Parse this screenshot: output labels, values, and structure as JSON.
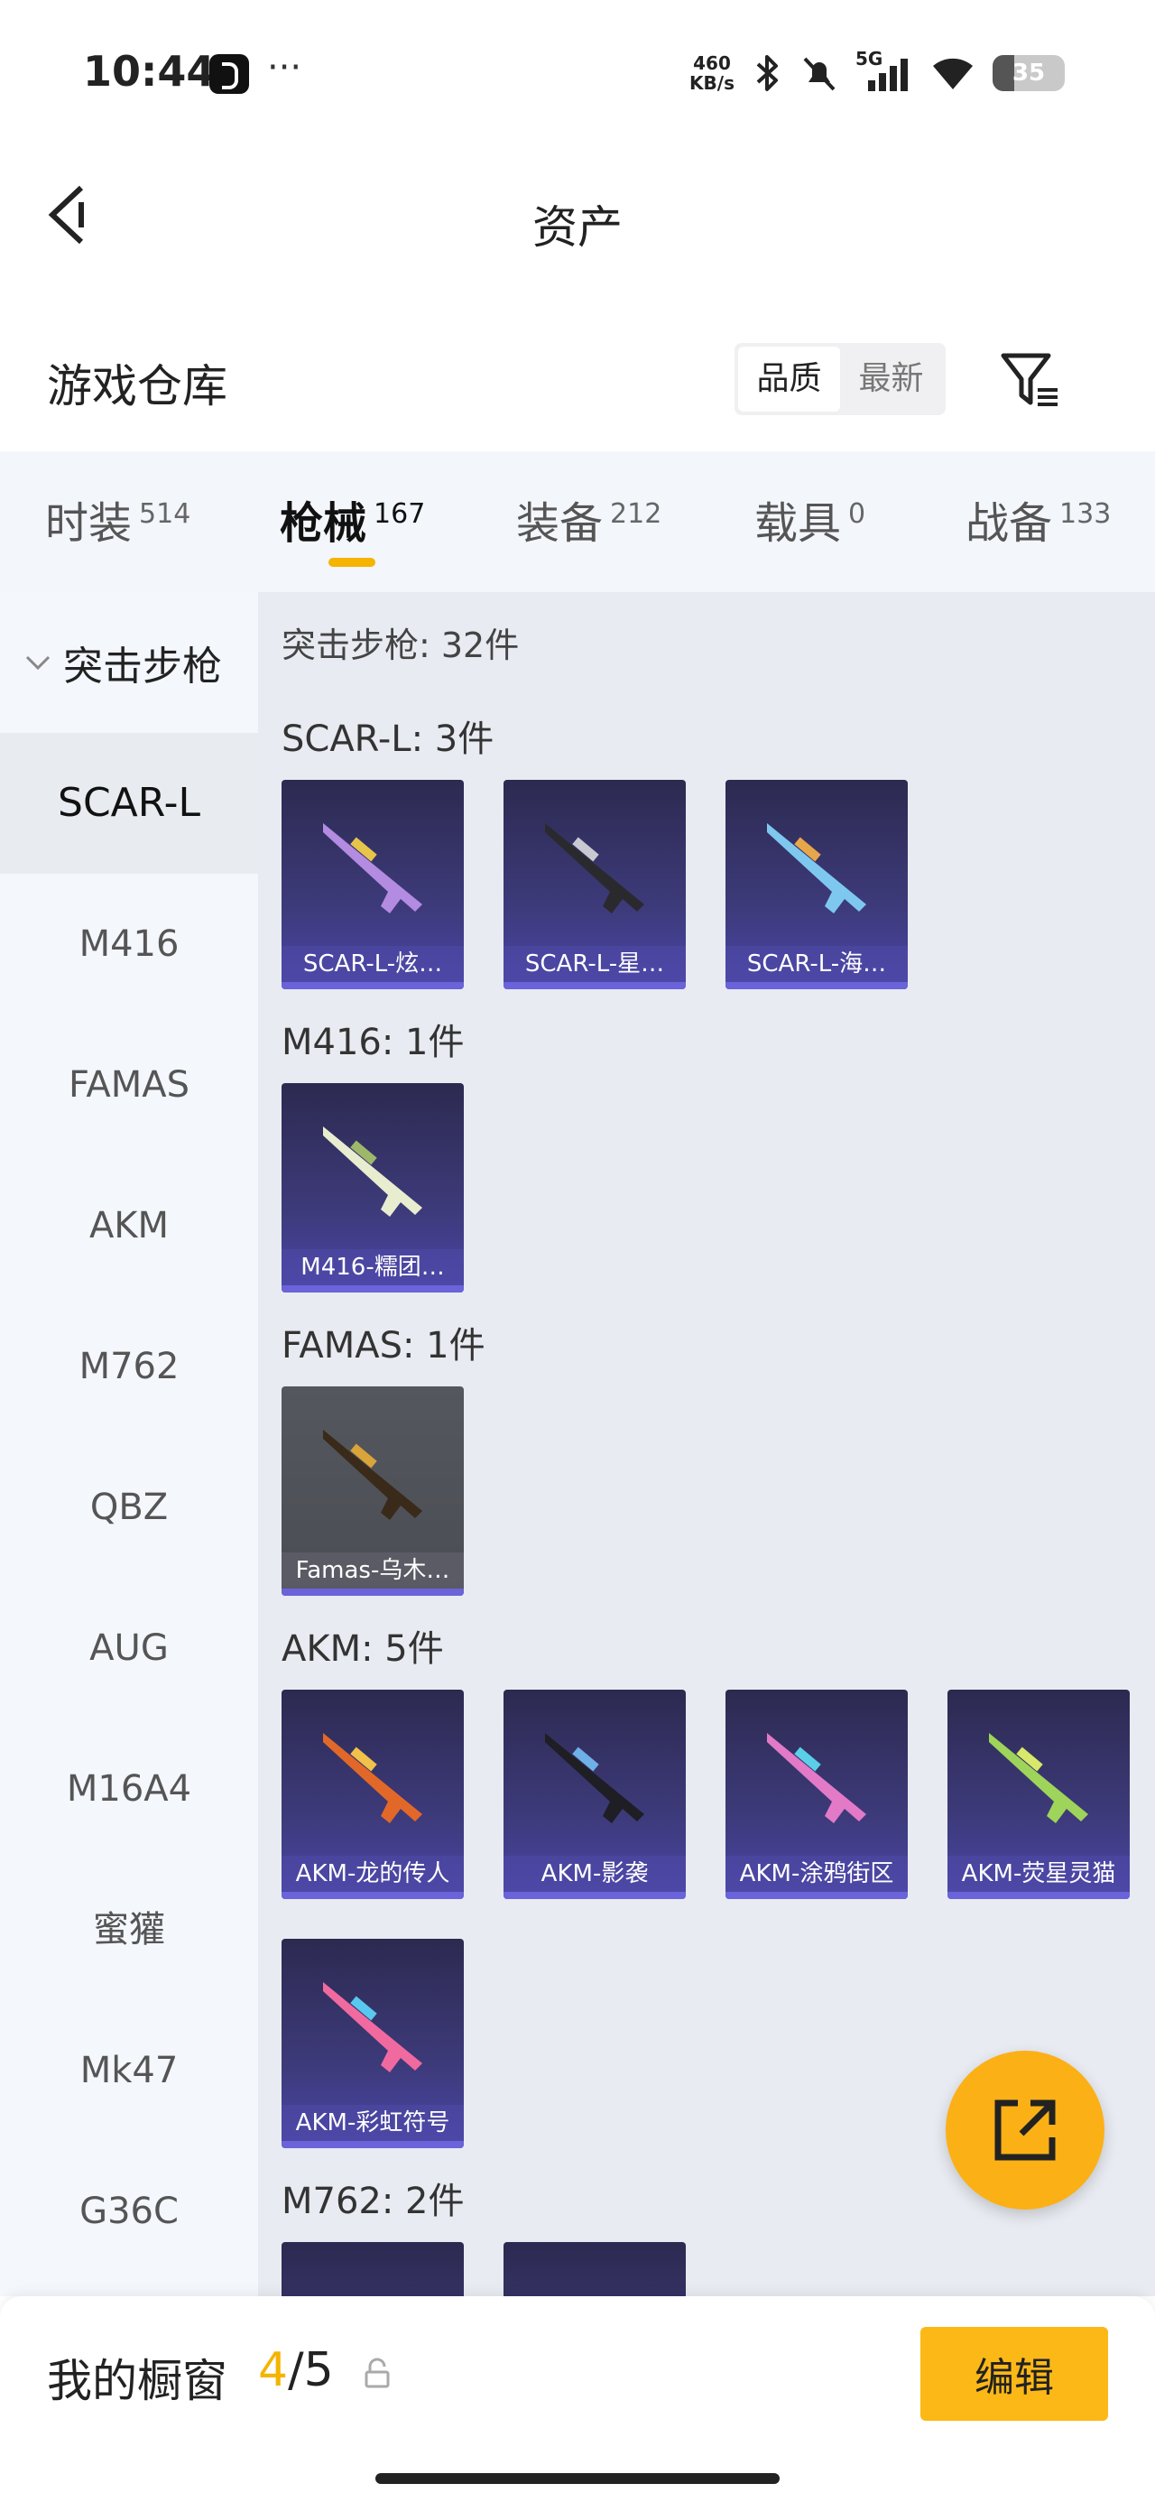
{
  "status_bar": {
    "time": "10:44",
    "more": "···",
    "net_speed_value": "460",
    "net_speed_unit": "KB/s",
    "network": "5G",
    "battery": "35"
  },
  "header": {
    "title": "资产"
  },
  "warehouse": {
    "title": "游戏仓库",
    "sort_options": [
      "品质",
      "最新"
    ],
    "sort_selected": "品质"
  },
  "tabs": [
    {
      "label": "时装",
      "count": "514"
    },
    {
      "label": "枪械",
      "count": "167",
      "active": true
    },
    {
      "label": "装备",
      "count": "212"
    },
    {
      "label": "载具",
      "count": "0"
    },
    {
      "label": "战备",
      "count": "133"
    }
  ],
  "sidebar": {
    "group": "突击步枪",
    "items": [
      "SCAR-L",
      "M416",
      "FAMAS",
      "AKM",
      "M762",
      "QBZ",
      "AUG",
      "M16A4",
      "蜜獾",
      "Mk47",
      "G36C"
    ],
    "active": "SCAR-L"
  },
  "content": {
    "category_title": "突击步枪: 32件",
    "groups": [
      {
        "label": "SCAR-L: 3件",
        "items": [
          "SCAR-L-炫…",
          "SCAR-L-星…",
          "SCAR-L-海…"
        ]
      },
      {
        "label": "M416: 1件",
        "items": [
          "M416-糯团…"
        ]
      },
      {
        "label": "FAMAS: 1件",
        "items": [
          "Famas-乌木…"
        ]
      },
      {
        "label": "AKM: 5件",
        "items": [
          "AKM-龙的传人",
          "AKM-影袭",
          "AKM-涂鸦街区",
          "AKM-荧星灵猫",
          "AKM-彩虹符号"
        ]
      },
      {
        "label": "M762: 2件",
        "items": [
          "",
          ""
        ]
      }
    ]
  },
  "bottom_bar": {
    "showcase_label": "我的橱窗",
    "showcase_current": "4",
    "showcase_sep": "/",
    "showcase_total": "5",
    "edit_label": "编辑"
  },
  "colors": {
    "accent": "#f5b400",
    "fab": "#fbb016",
    "tile_purple": "#3d3a7a",
    "tile_grey": "#4b4d54"
  }
}
